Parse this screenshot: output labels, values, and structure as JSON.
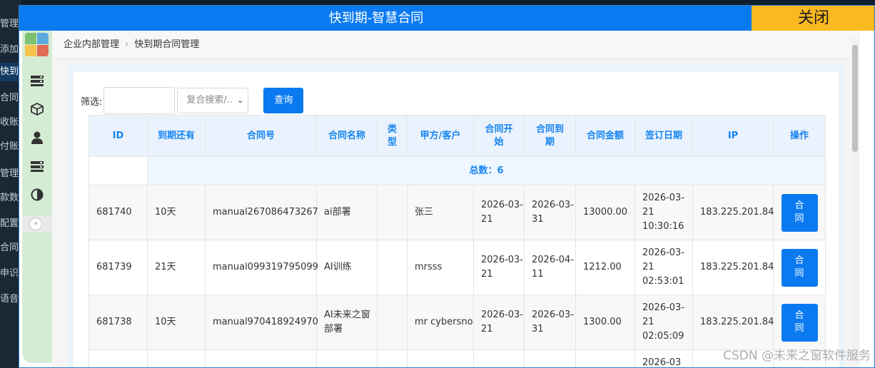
{
  "background_sidebar": [
    "管理",
    "添加",
    "快到",
    "合同",
    "收账",
    "付账",
    "管理",
    "款数",
    "配置",
    "合同",
    "申识",
    "语音"
  ],
  "modal": {
    "title": "快到期-智慧合同",
    "close_label": "关闭"
  },
  "rail": {
    "logo_colors": [
      "#7cc16f",
      "#5aabdc",
      "#f6c24c",
      "#e16b55"
    ],
    "icons": [
      "list-icon",
      "cube-icon",
      "user-icon",
      "stack-icon",
      "contrast-icon"
    ],
    "toggle_glyph": "»"
  },
  "breadcrumb": {
    "items": [
      "企业内部管理",
      "快到期合同管理"
    ],
    "separator": "›"
  },
  "filter": {
    "label": "筛选:",
    "input_value": "",
    "select_value": "复合搜索/..",
    "query_label": "查询"
  },
  "table": {
    "headers": [
      "ID",
      "到期还有",
      "合同号",
      "合同名称",
      "类型",
      "甲方/客户",
      "合同开始",
      "合同到期",
      "合同金额",
      "签订日期",
      "IP",
      "操作"
    ],
    "summary": "总数：6",
    "op_label": [
      "合",
      "同"
    ],
    "rows": [
      {
        "id": "681740",
        "remain": "10天",
        "number": "manual267086473267",
        "name": "ai部署",
        "type": "",
        "client": "张三",
        "start": "2026-03-21",
        "end": "2026-03-31",
        "amount": "13000.00",
        "signed": "2026-03-21 10:30:16",
        "ip": "183.225.201.84"
      },
      {
        "id": "681739",
        "remain": "21天",
        "number": "manual099319795099",
        "name": "AI训练",
        "type": "",
        "client": "mrsss",
        "start": "2026-03-21",
        "end": "2026-04-11",
        "amount": "1212.00",
        "signed": "2026-03-21 02:53:01",
        "ip": "183.225.201.84"
      },
      {
        "id": "681738",
        "remain": "10天",
        "number": "manual970418924970",
        "name": "AI未来之窗部署",
        "type": "",
        "client": "mr cybersno",
        "start": "2026-03-21",
        "end": "2026-03-31",
        "amount": "1300.00",
        "signed": "2026-03-21 02:05:09",
        "ip": "183.225.201.84"
      }
    ],
    "partial_row_signed": "2026-03"
  },
  "watermark": "CSDN @未来之窗软件服务"
}
